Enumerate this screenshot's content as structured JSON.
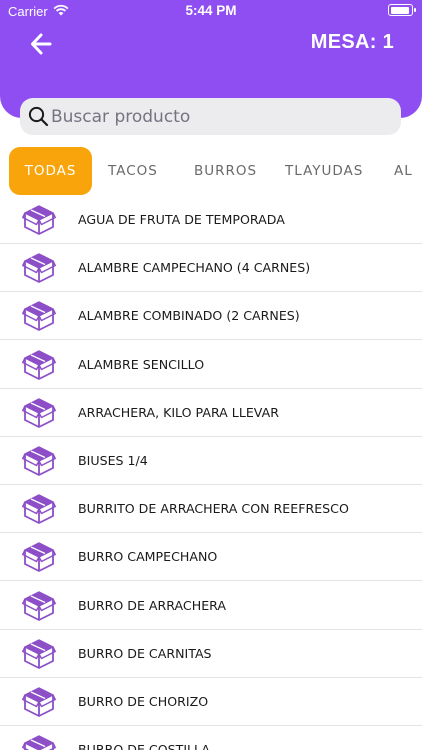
{
  "status_bar": {
    "carrier": "Carrier",
    "time": "5:44 PM",
    "battery_level": 0.95
  },
  "header": {
    "table_label": "MESA: 1",
    "back_icon": "arrow-left-icon"
  },
  "search": {
    "placeholder": "Buscar producto",
    "value": "",
    "icon": "search-icon"
  },
  "tabs": [
    {
      "label": "TODAS",
      "active": true
    },
    {
      "label": "TACOS",
      "active": false
    },
    {
      "label": "BURROS",
      "active": false
    },
    {
      "label": "TLAYUDAS",
      "active": false
    },
    {
      "label": "AL",
      "active": false
    }
  ],
  "products": [
    {
      "name": "AGUA DE FRUTA DE TEMPORADA"
    },
    {
      "name": "ALAMBRE CAMPECHANO (4 CARNES)"
    },
    {
      "name": "ALAMBRE COMBINADO (2 CARNES)"
    },
    {
      "name": "ALAMBRE SENCILLO"
    },
    {
      "name": "ARRACHERA, KILO PARA LLEVAR"
    },
    {
      "name": "BIUSES 1/4"
    },
    {
      "name": "BURRITO DE ARRACHERA CON REEFRESCO"
    },
    {
      "name": "BURRO CAMPECHANO"
    },
    {
      "name": "BURRO DE ARRACHERA"
    },
    {
      "name": "BURRO DE CARNITAS"
    },
    {
      "name": "BURRO DE CHORIZO"
    },
    {
      "name": "BURRO DE COSTILLA"
    }
  ],
  "product_icon": "package-box-icon",
  "colors": {
    "header": "#8f4ef2",
    "active_tab": "#f9a40a",
    "icon": "#8d4fc7"
  }
}
